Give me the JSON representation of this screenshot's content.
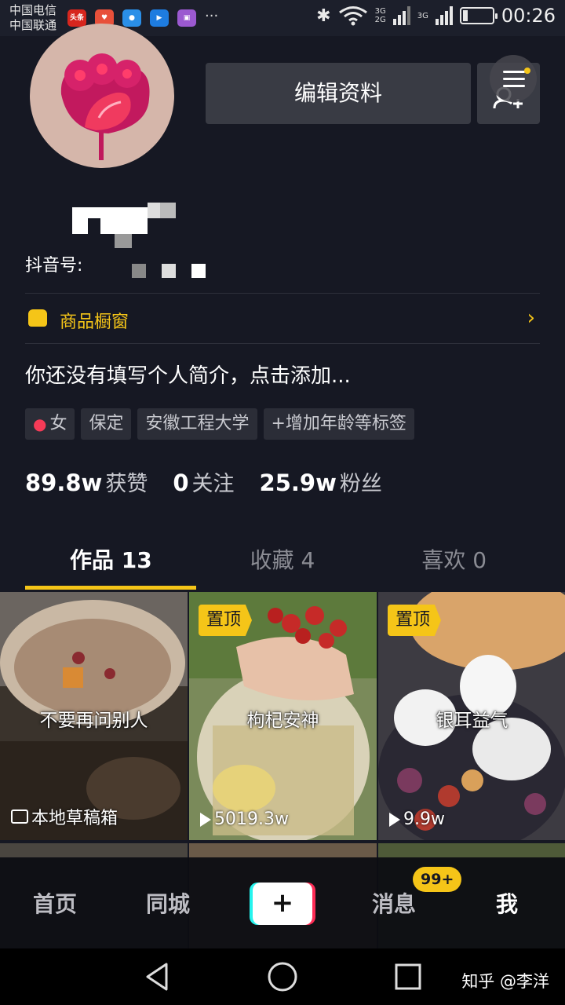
{
  "status_bar": {
    "carrier_1": "中国电信",
    "carrier_2": "中国联通",
    "toutiao_app": "头条",
    "signal_1": "3G",
    "signal_2": "2G",
    "signal_3": "3G",
    "time": "00:26"
  },
  "profile": {
    "edit_button": "编辑资料",
    "douyin_id_label": "抖音号:"
  },
  "shop_window": {
    "label": "商品橱窗"
  },
  "bio": "你还没有填写个人简介，点击添加...",
  "tags": [
    {
      "label": "女",
      "icon": "person-icon"
    },
    {
      "label": "保定"
    },
    {
      "label": "安徽工程大学"
    },
    {
      "label": "+增加年龄等标签"
    }
  ],
  "stats": {
    "likes_count": "89.8w",
    "likes_label": "获赞",
    "following_count": "0",
    "following_label": "关注",
    "followers_count": "25.9w",
    "followers_label": "粉丝"
  },
  "tabs": [
    {
      "label": "作品 13",
      "active": true
    },
    {
      "label": "收藏 4",
      "active": false
    },
    {
      "label": "喜欢 0",
      "active": false
    }
  ],
  "videos": [
    {
      "caption": "不要再问别人",
      "footer": "本地草稿箱",
      "pinned": false
    },
    {
      "caption": "枸杞安神",
      "views": "5019.3w",
      "pinned": true,
      "pinned_label": "置顶"
    },
    {
      "caption": "银耳益气",
      "views": "9.9w",
      "pinned": true,
      "pinned_label": "置顶"
    }
  ],
  "bottom_nav": {
    "home": "首页",
    "nearby": "同城",
    "create": "+",
    "messages": "消息",
    "messages_badge": "99+",
    "me": "我"
  },
  "watermark": "知乎 @李洋",
  "colors": {
    "background": "#161823",
    "accent": "#f5c518",
    "button": "#393b44",
    "tiktok_cyan": "#25f4ee",
    "tiktok_red": "#fe2c55"
  }
}
